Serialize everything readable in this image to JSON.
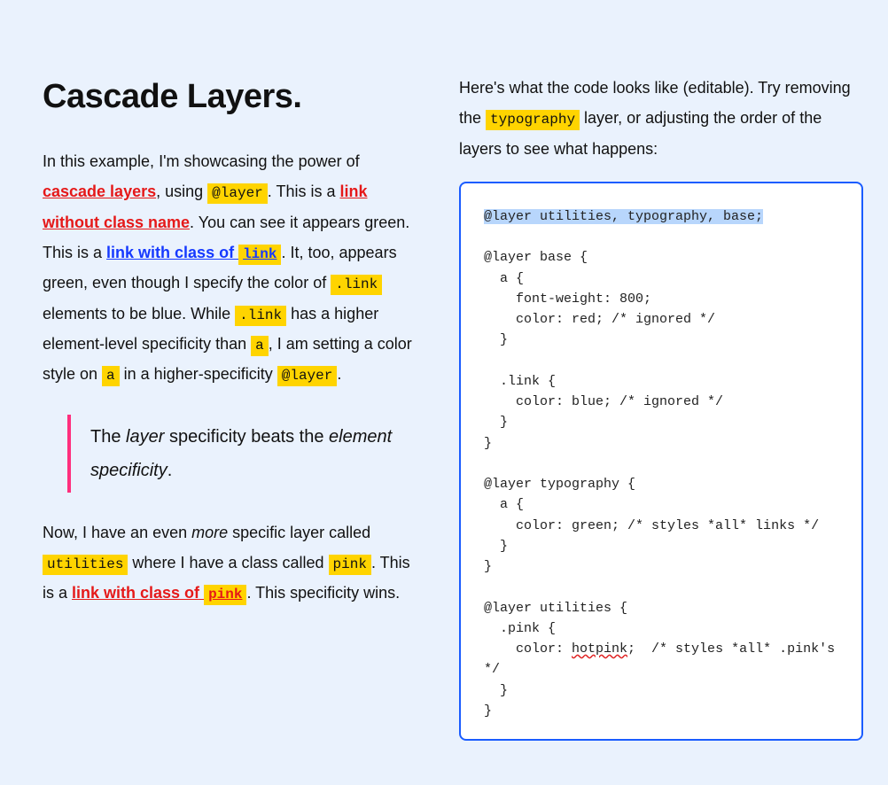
{
  "left": {
    "title": "Cascade Layers.",
    "p1_a": "In this example, I'm showcasing the power of ",
    "link_cascade": "cascade layers",
    "p1_b": ", using ",
    "code_layer1": "@layer",
    "p1_c": ". This is a ",
    "link_noclass": "link without class name",
    "p1_d": ". You can see it appears green. This is a ",
    "link_withclass_pre": "link with class of ",
    "code_link_in_link": "link",
    "p1_e": ". It, too, appears green, even though I specify the color of ",
    "code_dotlink1": ".link",
    "p1_f": " elements to be blue. While ",
    "code_dotlink2": ".link",
    "p1_g": " has a higher element-level specificity than ",
    "code_a1": "a",
    "p1_h": ", I am setting a color style on ",
    "code_a2": "a",
    "p1_i": " in a higher-specificity ",
    "code_layer2": "@layer",
    "p1_j": ".",
    "bq_a": "The ",
    "bq_em1": "layer",
    "bq_b": " specificity beats the ",
    "bq_em2": "element specificity",
    "bq_c": ".",
    "p2_a": "Now, I have an even ",
    "p2_em": "more",
    "p2_b": " specific layer called ",
    "code_utilities": "utilities",
    "p2_c": " where I have a class called ",
    "code_pink1": "pink",
    "p2_d": ". This is a ",
    "link_pink_pre": "link with class of ",
    "code_pink_in_link": "pink",
    "p2_e": ". This specificity wins."
  },
  "right": {
    "intro_a": "Here's what the code looks like (editable). Try removing the ",
    "intro_code": "typography",
    "intro_b": " layer, or adjusting the order of the layers to see what happens:",
    "code": {
      "sel": "@layer utilities, typography, base;",
      "l3": "@layer base {",
      "l4": "  a {",
      "l5": "    font-weight: 800;",
      "l6": "    color: red; /* ignored */",
      "l7": "  }",
      "l9": "  .link {",
      "l10": "    color: blue; /* ignored */",
      "l11": "  }",
      "l12": "}",
      "l14": "@layer typography {",
      "l15": "  a {",
      "l16": "    color: green; /* styles *all* links */",
      "l17": "  }",
      "l18": "}",
      "l20": "@layer utilities {",
      "l21": "  .pink {",
      "l22a": "    color: ",
      "l22b": "hotpink",
      "l22c": ";  /* styles *all* .pink's */",
      "l23": "  }",
      "l24": "}"
    }
  }
}
